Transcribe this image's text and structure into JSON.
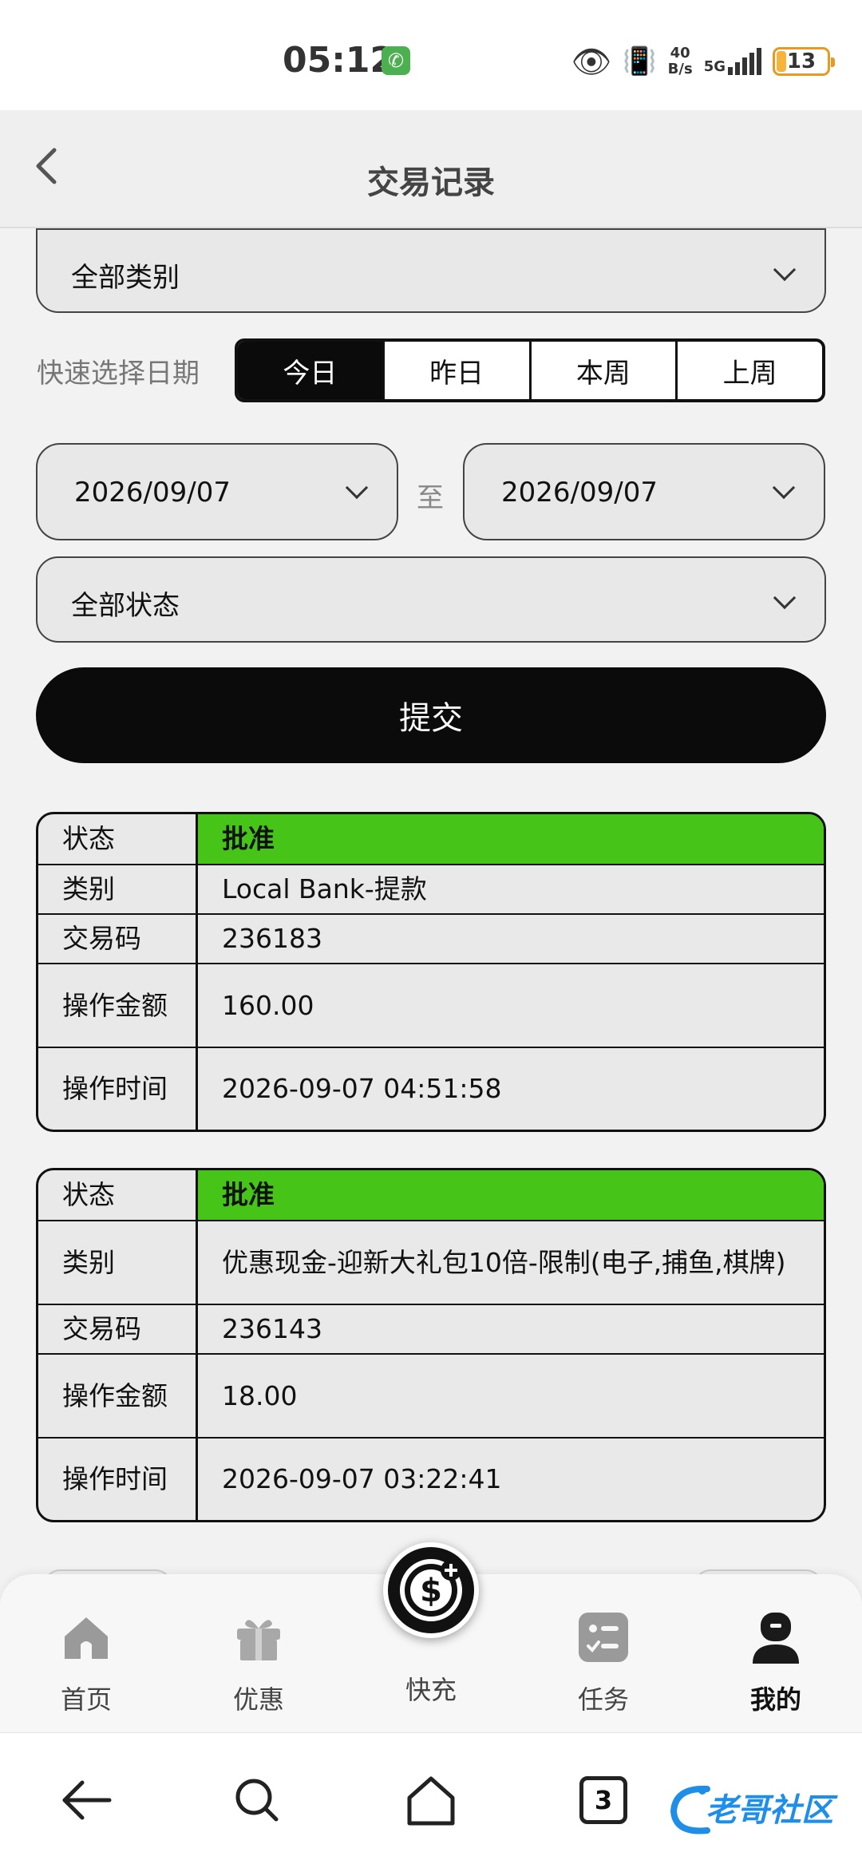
{
  "status_bar": {
    "time": "05:12",
    "net_speed_value": "40",
    "net_speed_unit": "B/s",
    "network": "5G",
    "battery": "13"
  },
  "header": {
    "title": "交易记录"
  },
  "filters": {
    "category": "全部类别",
    "quick_label": "快速选择日期",
    "quick_options": [
      "今日",
      "昨日",
      "本周",
      "上周"
    ],
    "quick_selected": "今日",
    "date_from": "2026/09/07",
    "date_sep": "至",
    "date_to": "2026/09/07",
    "status": "全部状态",
    "submit": "提交"
  },
  "records": [
    {
      "status": {
        "label": "状态",
        "value": "批准"
      },
      "category": {
        "label": "类别",
        "value": "Local Bank-提款"
      },
      "code": {
        "label": "交易码",
        "value": "236183"
      },
      "amount": {
        "label": "操作金额",
        "value": "160.00"
      },
      "time": {
        "label": "操作时间",
        "value": "2026-09-07 04:51:58"
      }
    },
    {
      "status": {
        "label": "状态",
        "value": "批准"
      },
      "category": {
        "label": "类别",
        "value": "优惠现金-迎新大礼包10倍-限制(电子,捕鱼,棋牌)"
      },
      "code": {
        "label": "交易码",
        "value": "236143"
      },
      "amount": {
        "label": "操作金额",
        "value": "18.00"
      },
      "time": {
        "label": "操作时间",
        "value": "2026-09-07 03:22:41"
      }
    }
  ],
  "tabbar": {
    "items": [
      {
        "label": "首页",
        "icon": "home-icon"
      },
      {
        "label": "优惠",
        "icon": "gift-icon"
      },
      {
        "label": "快充",
        "icon": "dollar-plus-icon"
      },
      {
        "label": "任务",
        "icon": "task-icon"
      },
      {
        "label": "我的",
        "icon": "user-icon"
      }
    ],
    "active": "我的"
  },
  "system_nav": {
    "tabs_count": "3"
  },
  "watermark": {
    "text": "老哥社区"
  },
  "colors": {
    "approved": "#46c418",
    "primary": "#0b0b0b",
    "battery": "#e69a22"
  }
}
